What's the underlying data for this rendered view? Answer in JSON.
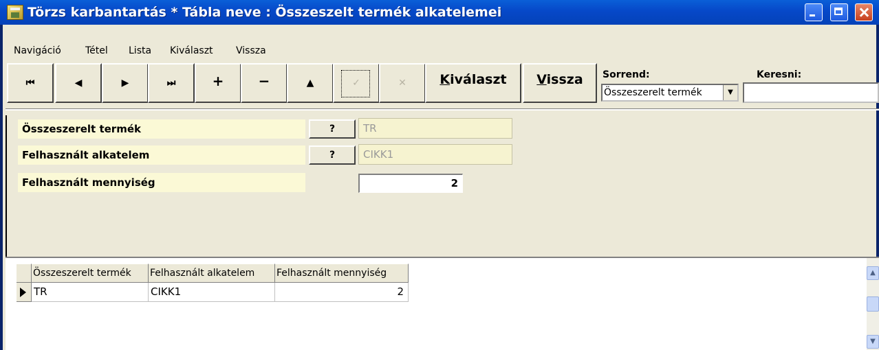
{
  "window": {
    "title": "Törzs karbantartás * Tábla neve : Összeszelt termék alkatelemei"
  },
  "menu": [
    "Navigáció",
    "Tétel",
    "Lista",
    "Kiválaszt",
    "Vissza"
  ],
  "toolbar": {
    "nav_glyphs": [
      "⏮",
      "◀",
      "▶",
      "⏭",
      "+",
      "−",
      "▲",
      "✓",
      "✕"
    ],
    "select_label_u": "K",
    "select_label_rest": "iválaszt",
    "back_label_u": "V",
    "back_label_rest": "issza",
    "sort_label": "Sorrend:",
    "sort_value": "Összeszerelt termék",
    "search_label": "Keresni:",
    "search_value": ""
  },
  "form": {
    "fields": [
      {
        "label": "Összeszerelt termék",
        "lookup": "?",
        "value": "TR"
      },
      {
        "label": "Felhasznált alkatelem",
        "lookup": "?",
        "value": "CIKK1"
      },
      {
        "label": "Felhasznált mennyiség",
        "value": "2"
      }
    ]
  },
  "grid": {
    "columns": [
      "Összeszerelt termék",
      "Felhasznált alkatelem",
      "Felhasznált mennyiség"
    ],
    "rows": [
      [
        "TR",
        "CIKK1",
        "2"
      ]
    ]
  }
}
